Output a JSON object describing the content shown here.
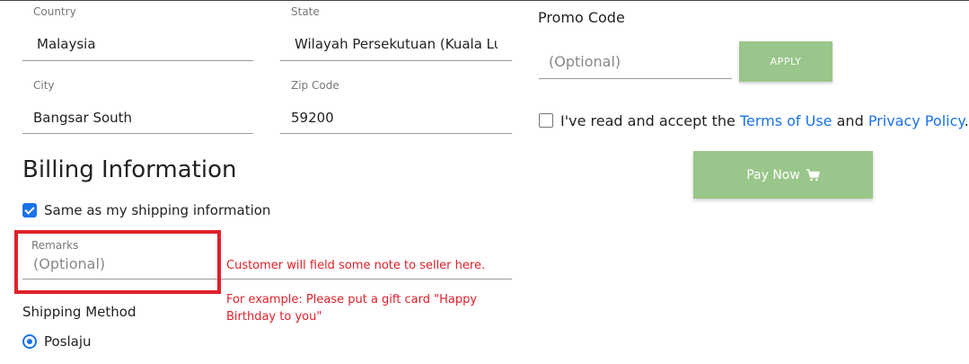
{
  "shipping": {
    "country": {
      "label": "Country",
      "value": "Malaysia"
    },
    "state": {
      "label": "State",
      "value": "Wilayah Persekutuan (Kuala Lu"
    },
    "city": {
      "label": "City",
      "value": "Bangsar South"
    },
    "zip": {
      "label": "Zip Code",
      "value": "59200"
    }
  },
  "billing": {
    "title": "Billing Information",
    "same_as_shipping_label": "Same as my shipping information",
    "same_as_shipping_checked": true
  },
  "remarks": {
    "label": "Remarks",
    "placeholder": "(Optional)"
  },
  "annotation": {
    "note_1": "Customer will field some note to seller here.",
    "note_2_line1": "For example: Please put a gift card \"Happy",
    "note_2_line2": "Birthday to you\"",
    "highlight_color": "#e0202a"
  },
  "shipping_method": {
    "label": "Shipping Method",
    "options": [
      {
        "label": "Poslaju",
        "selected": true
      }
    ]
  },
  "promo": {
    "label": "Promo Code",
    "placeholder": "(Optional)",
    "apply_label": "APPLY"
  },
  "terms": {
    "prefix": "I've read and accept the ",
    "terms_link": "Terms of Use",
    "and_text": " and ",
    "privacy_link": "Privacy Policy",
    "suffix": ".",
    "checked": false
  },
  "pay": {
    "label": "Pay Now",
    "icon": "cart-icon"
  },
  "colors": {
    "accent": "#1a73e8",
    "button_green": "#99c68a",
    "annotation_red": "#e0202a"
  }
}
